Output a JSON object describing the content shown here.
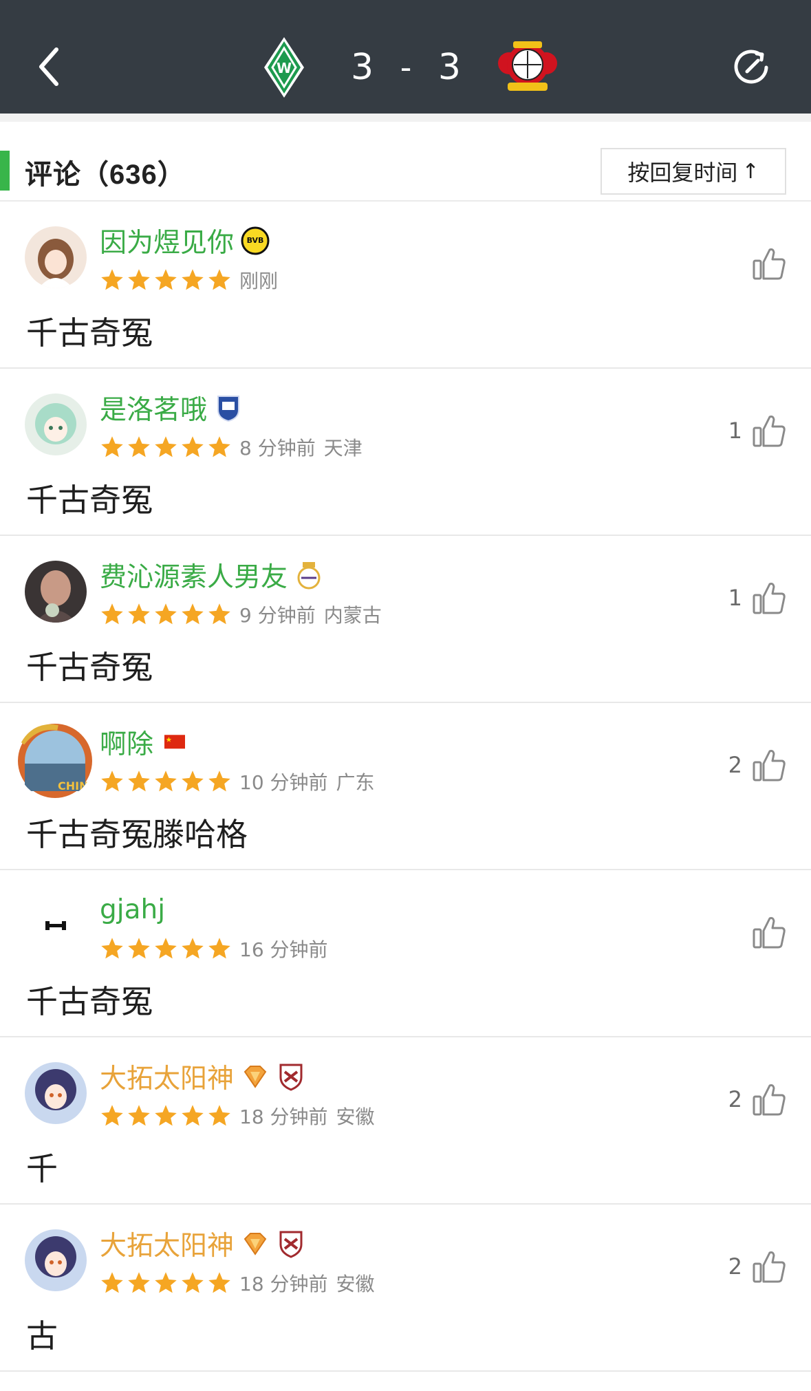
{
  "header": {
    "home_team_icon": "werder-bremen-logo",
    "home_score": "3",
    "separator": "-",
    "away_score": "3",
    "away_team_icon": "bayer-leverkusen-logo",
    "back_icon": "chevron-left-icon",
    "refresh_icon": "refresh-icon"
  },
  "section": {
    "title": "评论（636）",
    "sort_label": "按回复时间",
    "sort_arrow": "↑",
    "accent_color": "#38b54a"
  },
  "colors": {
    "header_bg": "#353c43",
    "username_green": "#3aab46",
    "username_orange": "#e8a33a",
    "star": "#f5a623"
  },
  "comments": [
    {
      "username": "因为煜见你",
      "name_color": "green",
      "rating": 5,
      "time": "刚刚",
      "location": "",
      "likes": "",
      "content": "千古奇冤",
      "badges": [
        "bvb-club-badge"
      ]
    },
    {
      "username": "是洛茗哦",
      "name_color": "green",
      "rating": 5,
      "time": "8 分钟前",
      "location": "天津",
      "likes": "1",
      "content": "千古奇冤",
      "badges": [
        "tianjin-club-badge"
      ]
    },
    {
      "username": "费沁源素人男友",
      "name_color": "green",
      "rating": 5,
      "time": "9 分钟前",
      "location": "内蒙古",
      "likes": "1",
      "content": "千古奇冤",
      "badges": [
        "real-madrid-badge"
      ]
    },
    {
      "username": "啊除",
      "name_color": "green",
      "rating": 5,
      "time": "10 分钟前",
      "location": "广东",
      "likes": "2",
      "content": "千古奇冤滕哈格",
      "badges": [
        "china-flag-icon"
      ]
    },
    {
      "username": "gjahj",
      "name_color": "green",
      "rating": 5,
      "time": "16 分钟前",
      "location": "",
      "likes": "",
      "content": "千古奇冤",
      "badges": []
    },
    {
      "username": "大拓太阳神",
      "name_color": "orange",
      "rating": 5,
      "time": "18 分钟前",
      "location": "安徽",
      "likes": "2",
      "content": "千",
      "badges": [
        "vip-diamond-badge",
        "shield-club-badge"
      ]
    },
    {
      "username": "大拓太阳神",
      "name_color": "orange",
      "rating": 5,
      "time": "18 分钟前",
      "location": "安徽",
      "likes": "2",
      "content": "古",
      "badges": [
        "vip-diamond-badge",
        "shield-club-badge"
      ]
    }
  ]
}
